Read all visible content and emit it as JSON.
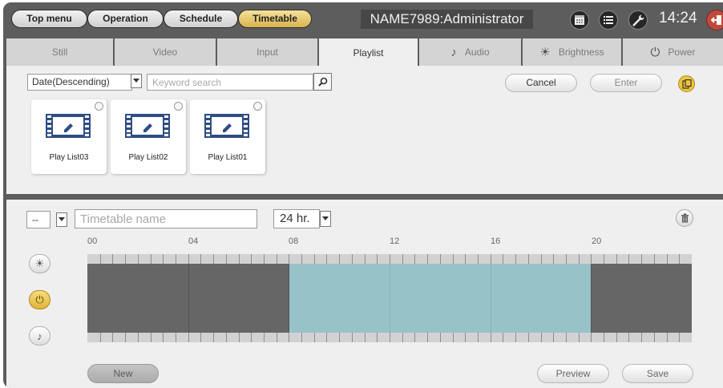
{
  "nav": {
    "items": [
      {
        "label": "Top menu",
        "active": false
      },
      {
        "label": "Operation",
        "active": false
      },
      {
        "label": "Schedule",
        "active": false
      },
      {
        "label": "Timetable",
        "active": true
      }
    ]
  },
  "header": {
    "user": "NAME7989:Administrator",
    "time": "14:24",
    "icons": [
      "calendar-icon",
      "list-icon",
      "wrench-icon",
      "logout-icon"
    ]
  },
  "tabs": [
    {
      "label": "Still",
      "icon": "",
      "active": false
    },
    {
      "label": "Video",
      "icon": "",
      "active": false
    },
    {
      "label": "Input",
      "icon": "",
      "active": false
    },
    {
      "label": "Playlist",
      "icon": "",
      "active": true
    },
    {
      "label": "Audio",
      "icon": "music-note-icon",
      "active": false
    },
    {
      "label": "Brightness",
      "icon": "sun-icon",
      "active": false
    },
    {
      "label": "Power",
      "icon": "power-icon",
      "active": false
    }
  ],
  "playlist_panel": {
    "sort_value": "Date(Descending)",
    "search_placeholder": "Keyword search",
    "cancel_label": "Cancel",
    "enter_label": "Enter",
    "cards": [
      {
        "name": "Play List03"
      },
      {
        "name": "Play List02"
      },
      {
        "name": "Play List01"
      }
    ]
  },
  "timetable": {
    "group_value": "--",
    "name_placeholder": "Timetable name",
    "hours_value": "24 hr.",
    "hour_labels": [
      "00",
      "04",
      "08",
      "12",
      "16",
      "20"
    ],
    "schedule": [
      {
        "start": 0,
        "end": 8,
        "state": "off"
      },
      {
        "start": 8,
        "end": 20,
        "state": "on"
      },
      {
        "start": 20,
        "end": 24,
        "state": "off"
      }
    ],
    "new_label": "New",
    "preview_label": "Preview",
    "save_label": "Save"
  },
  "colors": {
    "header_bg": "#5d5d5d",
    "accent_gold": "#e0b43b",
    "schedule_on": "#97c3c8",
    "schedule_off": "#666666",
    "panel_bg": "#efefef"
  }
}
